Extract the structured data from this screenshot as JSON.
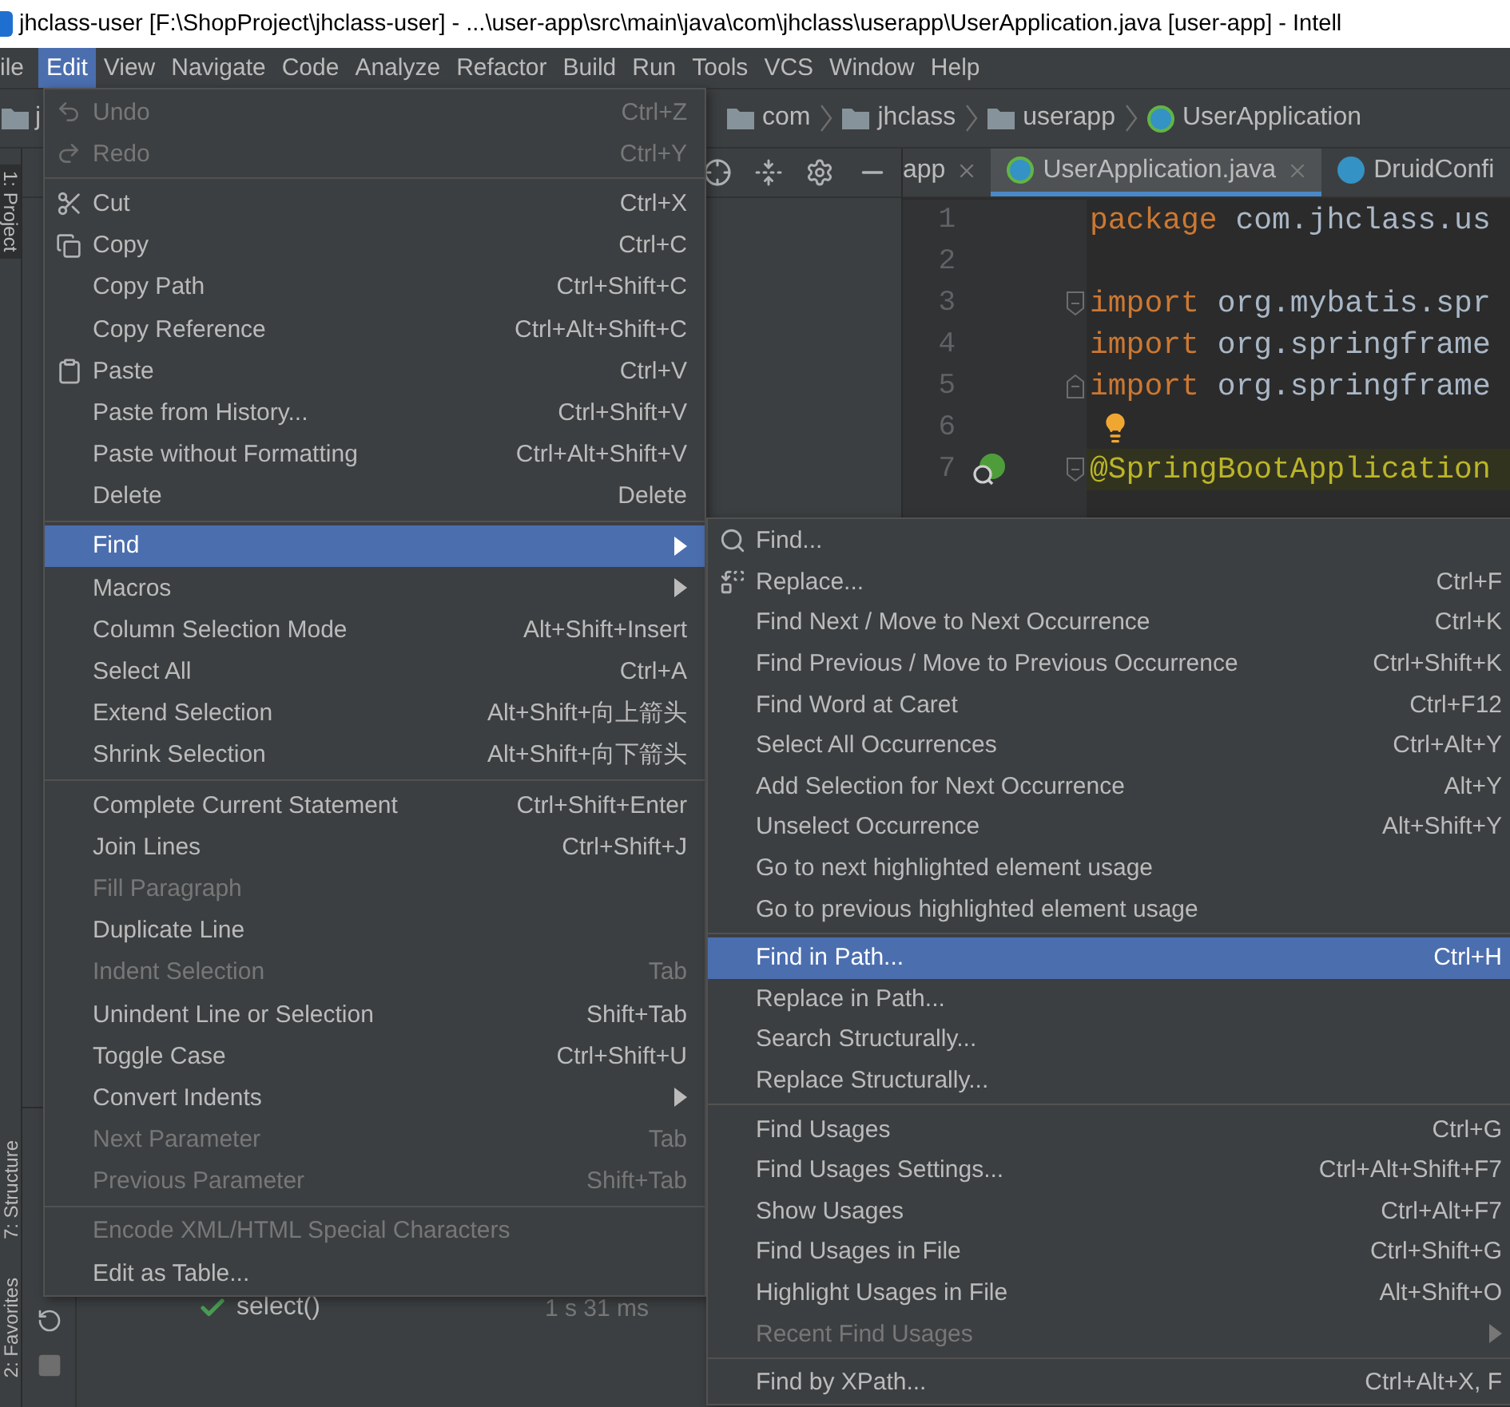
{
  "window": {
    "title": "jhclass-user [F:\\ShopProject\\jhclass-user] - ...\\user-app\\src\\main\\java\\com\\jhclass\\userapp\\UserApplication.java [user-app] - Intell"
  },
  "menu_bar": [
    {
      "label": "ile",
      "selected": false
    },
    {
      "label": "Edit",
      "selected": true
    },
    {
      "label": "View",
      "selected": false
    },
    {
      "label": "Navigate",
      "selected": false
    },
    {
      "label": "Code",
      "selected": false
    },
    {
      "label": "Analyze",
      "selected": false
    },
    {
      "label": "Refactor",
      "selected": false
    },
    {
      "label": "Build",
      "selected": false
    },
    {
      "label": "Run",
      "selected": false
    },
    {
      "label": "Tools",
      "selected": false
    },
    {
      "label": "VCS",
      "selected": false
    },
    {
      "label": "Window",
      "selected": false
    },
    {
      "label": "Help",
      "selected": false
    }
  ],
  "navigation_bar": {
    "project": "j",
    "crumbs": [
      "com",
      "jhclass",
      "userapp",
      "UserApplication"
    ]
  },
  "side_tabs": {
    "top": [
      {
        "label": "1: Project",
        "selected": true
      }
    ],
    "bottom": [
      {
        "label": "7: Structure",
        "selected": false
      },
      {
        "label": "2: Favorites",
        "selected": false
      }
    ]
  },
  "editor_tabs": [
    {
      "label": "app",
      "selected": false,
      "closable": true
    },
    {
      "label": "UserApplication.java",
      "selected": true,
      "closable": true
    },
    {
      "label": "DruidConfi",
      "selected": false,
      "closable": false
    }
  ],
  "editor": {
    "lines": [
      {
        "number": "1",
        "highlighted": false,
        "runnable": false,
        "intention": false,
        "fold_start": false,
        "fold_end": false,
        "tokens": [
          {
            "text": "package",
            "kind": "keyword"
          },
          {
            "text": " com.jhclass.us",
            "kind": "plain"
          }
        ]
      },
      {
        "number": "2",
        "highlighted": false,
        "runnable": false,
        "intention": false,
        "fold_start": false,
        "fold_end": false
      },
      {
        "number": "3",
        "highlighted": false,
        "runnable": false,
        "intention": false,
        "fold_start": true,
        "fold_end": false,
        "tokens": [
          {
            "text": "import",
            "kind": "keyword"
          },
          {
            "text": " org.mybatis.spr",
            "kind": "plain"
          }
        ]
      },
      {
        "number": "4",
        "highlighted": false,
        "runnable": false,
        "intention": false,
        "fold_start": false,
        "fold_end": false,
        "tokens": [
          {
            "text": "import",
            "kind": "keyword"
          },
          {
            "text": " org.springframe",
            "kind": "plain"
          }
        ]
      },
      {
        "number": "5",
        "highlighted": false,
        "runnable": false,
        "intention": false,
        "fold_start": false,
        "fold_end": true,
        "tokens": [
          {
            "text": "import",
            "kind": "keyword"
          },
          {
            "text": " org.springframe",
            "kind": "plain"
          }
        ]
      },
      {
        "number": "6",
        "highlighted": false,
        "runnable": false,
        "intention": true,
        "fold_start": false,
        "fold_end": false
      },
      {
        "number": "7",
        "highlighted": true,
        "runnable": true,
        "intention": false,
        "fold_start": true,
        "fold_end": false,
        "tokens": [
          {
            "text": "@SpringBootApplication",
            "kind": "annotation"
          }
        ]
      }
    ]
  },
  "run_panel": {
    "tests": [
      {
        "name": "select()",
        "duration": "1 s 31 ms",
        "passed": true
      }
    ]
  },
  "edit_menu": {
    "items": [
      {
        "kind": "item",
        "label": "Undo",
        "shortcut": "Ctrl+Z",
        "disabled": true,
        "selected": false
      },
      {
        "kind": "item",
        "label": "Redo",
        "shortcut": "Ctrl+Y",
        "disabled": true,
        "selected": false
      },
      {
        "kind": "separator"
      },
      {
        "kind": "item",
        "label": "Cut",
        "shortcut": "Ctrl+X",
        "disabled": false,
        "selected": false
      },
      {
        "kind": "item",
        "label": "Copy",
        "shortcut": "Ctrl+C",
        "disabled": false,
        "selected": false
      },
      {
        "kind": "item",
        "label": "Copy Path",
        "shortcut": "Ctrl+Shift+C",
        "disabled": false,
        "selected": false
      },
      {
        "kind": "item",
        "label": "Copy Reference",
        "shortcut": "Ctrl+Alt+Shift+C",
        "disabled": false,
        "selected": false
      },
      {
        "kind": "item",
        "label": "Paste",
        "shortcut": "Ctrl+V",
        "disabled": false,
        "selected": false
      },
      {
        "kind": "item",
        "label": "Paste from History...",
        "shortcut": "Ctrl+Shift+V",
        "disabled": false,
        "selected": false
      },
      {
        "kind": "item",
        "label": "Paste without Formatting",
        "shortcut": "Ctrl+Alt+Shift+V",
        "disabled": false,
        "selected": false
      },
      {
        "kind": "item",
        "label": "Delete",
        "shortcut": "Delete",
        "disabled": false,
        "selected": false
      },
      {
        "kind": "separator"
      },
      {
        "kind": "submenu",
        "label": "Find",
        "disabled": false,
        "selected": true
      },
      {
        "kind": "submenu",
        "label": "Macros",
        "disabled": false,
        "selected": false
      },
      {
        "kind": "item",
        "label": "Column Selection Mode",
        "shortcut": "Alt+Shift+Insert",
        "disabled": false,
        "selected": false
      },
      {
        "kind": "item",
        "label": "Select All",
        "shortcut": "Ctrl+A",
        "disabled": false,
        "selected": false
      },
      {
        "kind": "item",
        "label": "Extend Selection",
        "shortcut": "Alt+Shift+向上箭头",
        "disabled": false,
        "selected": false
      },
      {
        "kind": "item",
        "label": "Shrink Selection",
        "shortcut": "Alt+Shift+向下箭头",
        "disabled": false,
        "selected": false
      },
      {
        "kind": "separator"
      },
      {
        "kind": "item",
        "label": "Complete Current Statement",
        "shortcut": "Ctrl+Shift+Enter",
        "disabled": false,
        "selected": false
      },
      {
        "kind": "item",
        "label": "Join Lines",
        "shortcut": "Ctrl+Shift+J",
        "disabled": false,
        "selected": false
      },
      {
        "kind": "item",
        "label": "Fill Paragraph",
        "disabled": true,
        "selected": false
      },
      {
        "kind": "item",
        "label": "Duplicate Line",
        "disabled": false,
        "selected": false
      },
      {
        "kind": "item",
        "label": "Indent Selection",
        "shortcut": "Tab",
        "disabled": true,
        "selected": false
      },
      {
        "kind": "item",
        "label": "Unindent Line or Selection",
        "shortcut": "Shift+Tab",
        "disabled": false,
        "selected": false
      },
      {
        "kind": "item",
        "label": "Toggle Case",
        "shortcut": "Ctrl+Shift+U",
        "disabled": false,
        "selected": false
      },
      {
        "kind": "submenu",
        "label": "Convert Indents",
        "disabled": false,
        "selected": false
      },
      {
        "kind": "item",
        "label": "Next Parameter",
        "shortcut": "Tab",
        "disabled": true,
        "selected": false
      },
      {
        "kind": "item",
        "label": "Previous Parameter",
        "shortcut": "Shift+Tab",
        "disabled": true,
        "selected": false
      },
      {
        "kind": "separator"
      },
      {
        "kind": "item",
        "label": "Encode XML/HTML Special Characters",
        "disabled": true,
        "selected": false
      },
      {
        "kind": "item",
        "label": "Edit as Table...",
        "disabled": false,
        "selected": false
      }
    ]
  },
  "find_submenu": {
    "items": [
      {
        "kind": "item",
        "label": "Find...",
        "disabled": false,
        "selected": false
      },
      {
        "kind": "item",
        "label": "Replace...",
        "shortcut": "Ctrl+F",
        "disabled": false,
        "selected": false
      },
      {
        "kind": "item",
        "label": "Find Next / Move to Next Occurrence",
        "shortcut": "Ctrl+K",
        "disabled": false,
        "selected": false
      },
      {
        "kind": "item",
        "label": "Find Previous / Move to Previous Occurrence",
        "shortcut": "Ctrl+Shift+K",
        "disabled": false,
        "selected": false
      },
      {
        "kind": "item",
        "label": "Find Word at Caret",
        "shortcut": "Ctrl+F12",
        "disabled": false,
        "selected": false
      },
      {
        "kind": "item",
        "label": "Select All Occurrences",
        "shortcut": "Ctrl+Alt+Y",
        "disabled": false,
        "selected": false
      },
      {
        "kind": "item",
        "label": "Add Selection for Next Occurrence",
        "shortcut": "Alt+Y",
        "disabled": false,
        "selected": false
      },
      {
        "kind": "item",
        "label": "Unselect Occurrence",
        "shortcut": "Alt+Shift+Y",
        "disabled": false,
        "selected": false
      },
      {
        "kind": "item",
        "label": "Go to next highlighted element usage",
        "disabled": false,
        "selected": false
      },
      {
        "kind": "item",
        "label": "Go to previous highlighted element usage",
        "disabled": false,
        "selected": false
      },
      {
        "kind": "separator"
      },
      {
        "kind": "item",
        "label": "Find in Path...",
        "shortcut": "Ctrl+H",
        "disabled": false,
        "selected": true
      },
      {
        "kind": "item",
        "label": "Replace in Path...",
        "disabled": false,
        "selected": false
      },
      {
        "kind": "item",
        "label": "Search Structurally...",
        "disabled": false,
        "selected": false
      },
      {
        "kind": "item",
        "label": "Replace Structurally...",
        "disabled": false,
        "selected": false
      },
      {
        "kind": "separator"
      },
      {
        "kind": "item",
        "label": "Find Usages",
        "shortcut": "Ctrl+G",
        "disabled": false,
        "selected": false
      },
      {
        "kind": "item",
        "label": "Find Usages Settings...",
        "shortcut": "Ctrl+Alt+Shift+F7",
        "disabled": false,
        "selected": false
      },
      {
        "kind": "item",
        "label": "Show Usages",
        "shortcut": "Ctrl+Alt+F7",
        "disabled": false,
        "selected": false
      },
      {
        "kind": "item",
        "label": "Find Usages in File",
        "shortcut": "Ctrl+Shift+G",
        "disabled": false,
        "selected": false
      },
      {
        "kind": "item",
        "label": "Highlight Usages in File",
        "shortcut": "Alt+Shift+O",
        "disabled": false,
        "selected": false
      },
      {
        "kind": "submenu",
        "label": "Recent Find Usages",
        "disabled": true,
        "selected": false
      },
      {
        "kind": "separator"
      },
      {
        "kind": "item",
        "label": "Find by XPath...",
        "shortcut": "Ctrl+Alt+X, F",
        "disabled": false,
        "selected": false
      }
    ]
  }
}
